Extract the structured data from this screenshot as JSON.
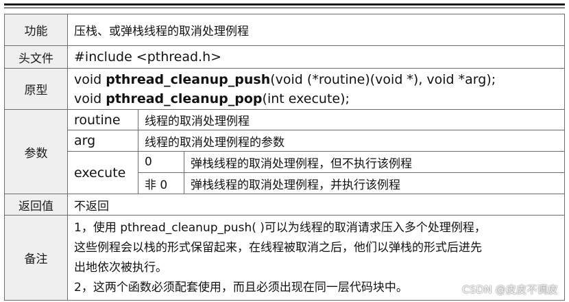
{
  "rows": {
    "function": {
      "label": "功能",
      "value": "压栈、或弹栈线程的取消处理例程"
    },
    "header": {
      "label": "头文件",
      "value": "#include <pthread.h>"
    },
    "prototype": {
      "label": "原型",
      "line1": {
        "prefix": "void ",
        "name": "pthread_cleanup_push",
        "suffix": "(void (*routine)(void *), void *arg);"
      },
      "line2": {
        "prefix": "void ",
        "name": "pthread_cleanup_pop",
        "suffix": "(int execute);"
      }
    },
    "params": {
      "label": "参数",
      "routine": {
        "name": "routine",
        "desc": "线程的取消处理例程"
      },
      "arg": {
        "name": "arg",
        "desc": "线程的取消处理例程的参数"
      },
      "execute": {
        "name": "execute",
        "options": [
          {
            "value": "0",
            "desc": "弹栈线程的取消处理例程，但不执行该例程"
          },
          {
            "value": "非 0",
            "desc": "弹栈线程的取消处理例程，并执行该例程"
          }
        ]
      }
    },
    "return": {
      "label": "返回值",
      "value": "不返回"
    },
    "notes": {
      "label": "备注",
      "lines": [
        "1，使用 pthread_cleanup_push( )可以为线程的取消请求压入多个处理例程，",
        "这些例程会以栈的形式保留起来，在线程被取消之后，他们以弹栈的形式后进先",
        "出地依次被执行。",
        "2，这两个函数必须配套使用，而且必须出现在同一层代码块中。"
      ]
    }
  },
  "watermark": "CSDN @皮皮不调皮"
}
